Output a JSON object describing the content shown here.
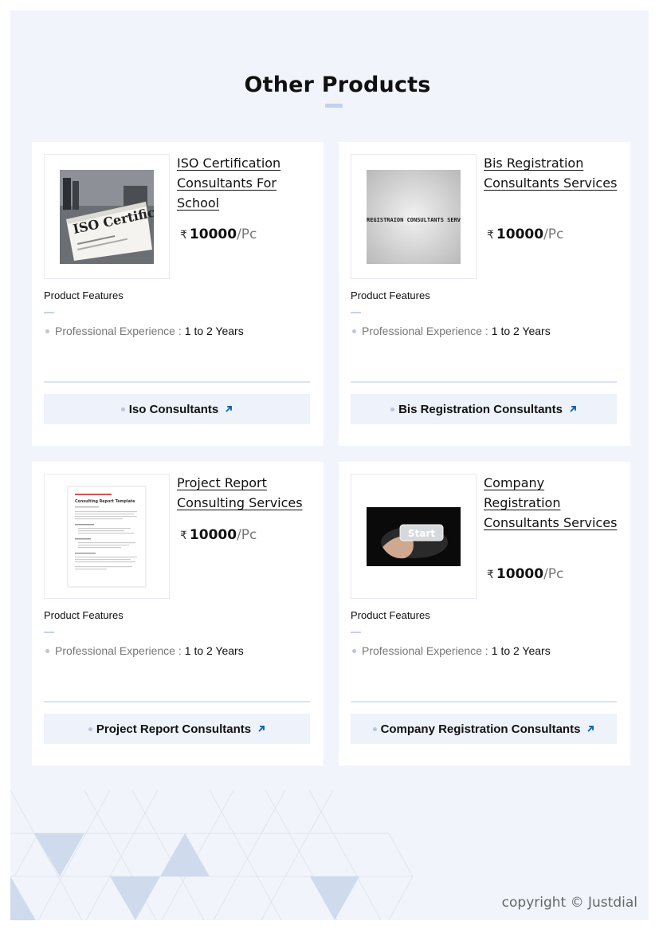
{
  "section": {
    "title": "Other Products"
  },
  "colors": {
    "accent": "#0a66b0",
    "tint": "#c4d1ee",
    "page_bg": "#f1f5fb"
  },
  "products": [
    {
      "name": "ISO Certification Consultants For School",
      "image_text": "ISO Certification Consultants Sheet",
      "currency": "₹",
      "price": "10000",
      "unit": "/Pc",
      "features_title": "Product Features",
      "feature_key": "Professional Experience :",
      "feature_value": "1 to 2 Years",
      "cta": "Iso Consultants"
    },
    {
      "name": "Bis Registration Consultants Services",
      "image_text": "BIS REGISTRAION CONSULTANTS SERVICES",
      "currency": "₹",
      "price": "10000",
      "unit": "/Pc",
      "features_title": "Product Features",
      "feature_key": "Professional Experience :",
      "feature_value": "1 to 2 Years",
      "cta": "Bis Registration Consultants"
    },
    {
      "name": "Project Report Consulting Services",
      "image_text": "Consulting Report Template",
      "currency": "₹",
      "price": "10000",
      "unit": "/Pc",
      "features_title": "Product Features",
      "feature_key": "Professional Experience :",
      "feature_value": "1 to 2 Years",
      "cta": "Project Report Consultants"
    },
    {
      "name": "Company Registration Consultants Services",
      "image_text": "Start",
      "currency": "₹",
      "price": "10000",
      "unit": "/Pc",
      "features_title": "Product Features",
      "feature_key": "Professional Experience :",
      "feature_value": "1 to 2 Years",
      "cta": "Company Registration Consultants"
    }
  ],
  "footer": {
    "copyright": "copyright © Justdial"
  }
}
